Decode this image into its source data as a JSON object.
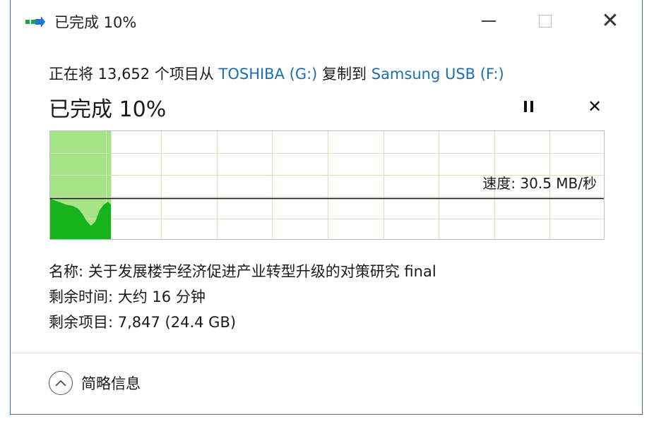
{
  "window": {
    "title": "已完成 10%",
    "icon": "copy-arrow-icon",
    "buttons": {
      "minimize": "minimize-icon",
      "maximize": "maximize-icon",
      "close": "close-icon"
    }
  },
  "copy_status": {
    "prefix": "正在将 13,652 个项目从 ",
    "source": "TOSHIBA (G:)",
    "middle": " 复制到 ",
    "destination": "Samsung USB (F:)"
  },
  "progress": {
    "title": "已完成 10%",
    "percent": 10,
    "speed": "速度: 30.5 MB/秒"
  },
  "details": {
    "name": "名称: 关于发展楼宇经济促进产业转型升级的对策研究 final",
    "time_remaining": "剩余时间: 大约 16 分钟",
    "items_remaining": "剩余项目: 7,847 (24.4 GB)"
  },
  "footer": {
    "toggle_label": "简略信息"
  },
  "colors": {
    "progress_fill": "#a6e389",
    "throughput_fill": "#17b21c",
    "grid_line": "#c9e9bd",
    "link": "#1a6fb5",
    "border": "#2f6db5"
  }
}
